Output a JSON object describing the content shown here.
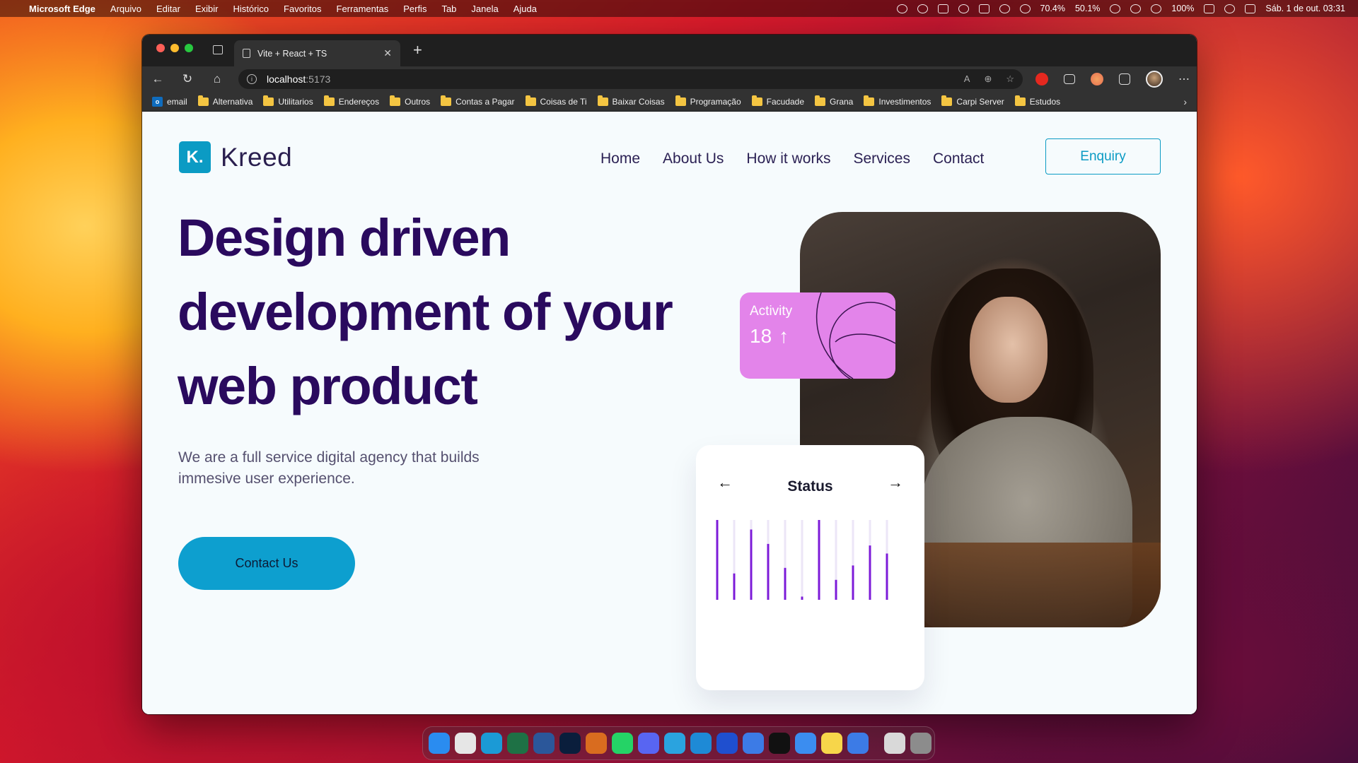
{
  "menubar": {
    "app_name": "Microsoft Edge",
    "menus": [
      "Arquivo",
      "Editar",
      "Exibir",
      "Histórico",
      "Favoritos",
      "Ferramentas",
      "Perfis",
      "Tab",
      "Janela",
      "Ajuda"
    ],
    "cpu_1": "70.4%",
    "cpu_2": "50.1%",
    "battery": "100%",
    "datetime": "Sáb. 1 de out.  03:31"
  },
  "browser": {
    "tab_title": "Vite + React + TS",
    "address_host": "localhost",
    "address_port": ":5173",
    "bookmarks": [
      "email",
      "Alternativa",
      "Utilitarios",
      "Endereços",
      "Outros",
      "Contas a Pagar",
      "Coisas de Ti",
      "Baixar Coisas",
      "Programação",
      "Facudade",
      "Grana",
      "Investimentos",
      "Carpi Server",
      "Estudos"
    ]
  },
  "site": {
    "logo_mark": "K.",
    "logo_text": "Kreed",
    "nav": [
      "Home",
      "About Us",
      "How it works",
      "Services",
      "Contact"
    ],
    "enquiry_label": "Enquiry",
    "headline": "Design driven development of your web product",
    "subheadline": "We are a full service digital agency that builds immesive user experience.",
    "cta_label": "Contact Us",
    "activity": {
      "label": "Activity",
      "value": "18",
      "arrow": "↑"
    },
    "status": {
      "title": "Status",
      "prev": "←",
      "next": "→",
      "bars": [
        1.0,
        0.33,
        0.88,
        0.7,
        0.4,
        0.04,
        1.0,
        0.25,
        0.43,
        0.68,
        0.58
      ]
    },
    "colors": {
      "brand": "#0b9bc4",
      "headline": "#2a0a5e",
      "activity_card": "#e384ea",
      "bar": "#7c1bd8",
      "bar_track": "#ece6f7"
    }
  },
  "dock": {
    "apps": [
      {
        "name": "finder",
        "color": "#2a8cf0"
      },
      {
        "name": "launchpad",
        "color": "#e6e6e6"
      },
      {
        "name": "edge",
        "color": "#1b9ad6"
      },
      {
        "name": "excel",
        "color": "#1e7145"
      },
      {
        "name": "word",
        "color": "#2b579a"
      },
      {
        "name": "photoshop",
        "color": "#0a1e3c"
      },
      {
        "name": "burger-app",
        "color": "#d96c1f"
      },
      {
        "name": "whatsapp",
        "color": "#25d366"
      },
      {
        "name": "discord",
        "color": "#5865f2"
      },
      {
        "name": "telegram",
        "color": "#2aa3df"
      },
      {
        "name": "vscode",
        "color": "#1e8ad6"
      },
      {
        "name": "screens",
        "color": "#1f4fcf"
      },
      {
        "name": "app-blue-moon",
        "color": "#3c7be6"
      },
      {
        "name": "terminal",
        "color": "#111111"
      },
      {
        "name": "mail",
        "color": "#3b8df0"
      },
      {
        "name": "notes",
        "color": "#f7d64a"
      },
      {
        "name": "app-blue-moon-2",
        "color": "#3c7be6"
      }
    ]
  }
}
